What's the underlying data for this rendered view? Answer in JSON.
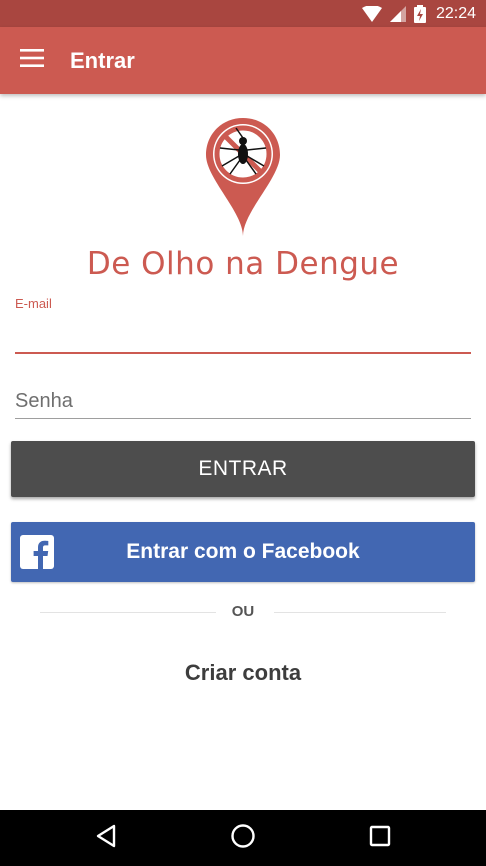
{
  "status_bar": {
    "time": "22:24"
  },
  "app_bar": {
    "title": "Entrar"
  },
  "brand": {
    "name": "De Olho na Dengue"
  },
  "form": {
    "email_label": "E-mail",
    "email_value": "",
    "password_placeholder": "Senha",
    "submit_label": "ENTRAR",
    "facebook_label": "Entrar com o Facebook",
    "divider_text": "OU",
    "create_account_label": "Criar conta"
  },
  "colors": {
    "primary": "#cc5a51",
    "status_bar": "#a94640",
    "submit_button": "#4d4d4d",
    "facebook": "#4267b2"
  },
  "icons": {
    "menu": "hamburger-menu-icon",
    "logo": "map-pin-mosquito-icon",
    "facebook": "facebook-f-icon",
    "back": "back-triangle-icon",
    "home": "home-circle-icon",
    "recent": "recent-apps-square-icon"
  }
}
